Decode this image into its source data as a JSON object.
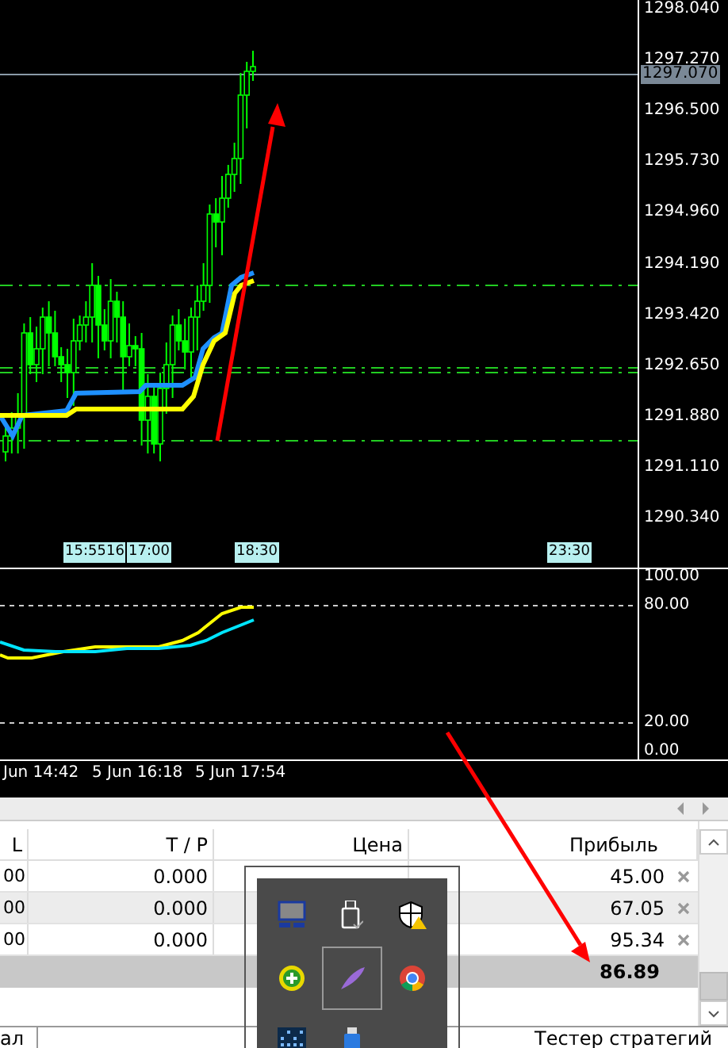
{
  "chart": {
    "price_ticks": [
      "1298.040",
      "1297.270",
      "1296.500",
      "1295.730",
      "1294.960",
      "1294.190",
      "1293.420",
      "1292.650",
      "1291.880",
      "1291.110",
      "1290.340"
    ],
    "current_price": "1297.070",
    "time_markers": [
      "15:55",
      "16",
      "17:00",
      "18:30",
      "23:30"
    ]
  },
  "oscillator": {
    "levels": [
      "100.00",
      "80.00",
      "20.00",
      "0.00"
    ]
  },
  "date_axis": [
    "Jun 14:42",
    "5 Jun 16:18",
    "5 Jun 17:54"
  ],
  "terminal": {
    "columns": [
      "L",
      "T / P",
      "Цена",
      "Прибыль"
    ],
    "rows": [
      {
        "column_1": "00",
        "tp": "0.000",
        "profit": "45.00"
      },
      {
        "column_1": "00",
        "tp": "0.000",
        "profit": "67.05"
      },
      {
        "column_1": "00",
        "tp": "0.000",
        "profit": "95.34"
      }
    ],
    "total": "86.89",
    "tabs": [
      {
        "label": "ал"
      },
      {
        "label": "Тестер стратегий"
      }
    ]
  },
  "tray": {
    "icons": [
      {
        "kind": "monitor",
        "selected": false
      },
      {
        "kind": "usb-drive",
        "selected": false
      },
      {
        "kind": "shield",
        "selected": false
      },
      {
        "kind": "plus",
        "selected": false
      },
      {
        "kind": "feather",
        "selected": true
      },
      {
        "kind": "browser",
        "selected": false
      },
      {
        "kind": "grid",
        "selected": false
      },
      {
        "kind": "usb-stick",
        "selected": false
      }
    ]
  }
}
